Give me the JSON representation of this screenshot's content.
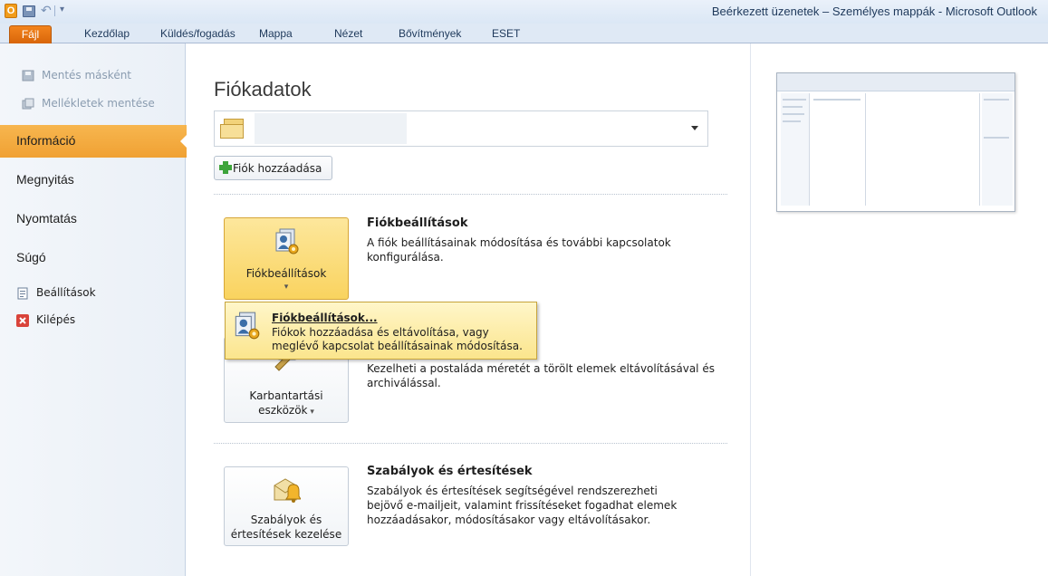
{
  "window": {
    "title": "Beérkezett üzenetek – Személyes mappák  -  Microsoft Outlook",
    "app_icon_letter": "O"
  },
  "ribbon": {
    "tabs": [
      "Fájl",
      "Kezdőlap",
      "Küldés/fogadás",
      "Mappa",
      "Nézet",
      "Bővítmények",
      "ESET"
    ]
  },
  "leftnav": {
    "disabled_items": [
      "Mentés másként",
      "Mellékletek mentése"
    ],
    "items": [
      "Információ",
      "Megnyitás",
      "Nyomtatás",
      "Súgó"
    ],
    "commands": [
      "Beállítások",
      "Kilépés"
    ],
    "active_item": "Információ"
  },
  "main": {
    "title": "Fiókadatok",
    "add_account_label": "Fiók hozzáadása",
    "sections": [
      {
        "button_label": "Fiókbeállítások",
        "title": "Fiókbeállítások",
        "description": "A fiók beállításainak módosítása és további kapcsolatok konfigurálása."
      },
      {
        "button_label_line1": "Karbantartási",
        "button_label_line2": "eszközök",
        "description": "Kezelheti a postaláda méretét a törölt elemek eltávolításával és archiválással."
      },
      {
        "button_label_line1": "Szabályok és",
        "button_label_line2": "értesítések kezelése",
        "title": "Szabályok és értesítések",
        "description": "Szabályok és értesítések segítségével rendszerezheti bejövő e-mailjeit, valamint frissítéseket fogadhat elemek hozzáadásakor, módosításakor vagy eltávolításakor."
      }
    ]
  },
  "popup": {
    "title": "Fiókbeállítások...",
    "description": "Fiókok hozzáadása és eltávolítása, vagy meglévő kapcsolat beállításainak módosítása."
  },
  "colors": {
    "file_tab": "#e6741a",
    "active_nav": "#f4ad42",
    "button_highlight": "#fad766"
  }
}
